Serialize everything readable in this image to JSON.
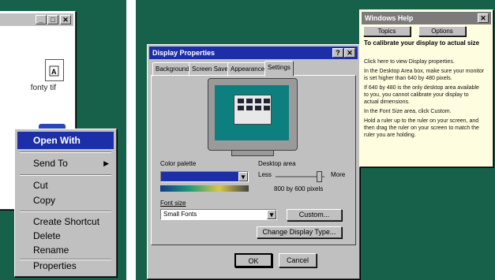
{
  "explorer": {
    "file_label": "fonty tif",
    "controls": {
      "minimize": "_",
      "maximize": "□",
      "close": "✕"
    }
  },
  "context_menu": {
    "items": [
      {
        "label": "Open With",
        "accel": "O",
        "selected": true
      },
      {
        "label": "Send To",
        "accel": "n",
        "submenu": true
      },
      {
        "label": "Cut",
        "accel": "t"
      },
      {
        "label": "Copy",
        "accel": "C"
      },
      {
        "label": "Create Shortcut",
        "accel": "S"
      },
      {
        "label": "Delete",
        "accel": "D"
      },
      {
        "label": "Rename",
        "accel": "m"
      },
      {
        "label": "Properties",
        "accel": "r"
      }
    ]
  },
  "display_properties": {
    "title": "Display Properties",
    "tabs": [
      "Background",
      "Screen Saver",
      "Appearance",
      "Settings"
    ],
    "active_tab": "Settings",
    "color_palette_label": "Color palette",
    "desktop_area_label": "Desktop area",
    "slider_less": "Less",
    "slider_more": "More",
    "resolution_text": "800 by 600 pixels",
    "font_size_label": "Font size",
    "font_size_value": "Small Fonts",
    "custom_button": "Custom...",
    "change_display_type_button": "Change Display Type...",
    "ok_button": "OK",
    "cancel_button": "Cancel"
  },
  "help": {
    "title": "Windows Help",
    "topics_button": "Topics",
    "options_button": "Options",
    "heading": "To calibrate your display to actual size",
    "lines": [
      "Click here to view Display properties.",
      "In the Desktop Area box, make sure your monitor",
      "is set higher than 640 by 480 pixels.",
      "If 640 by 480 is the only desktop area available",
      "to you, you cannot calibrate your display to",
      "actual dimensions.",
      "In the Font Size area, click Custom.",
      "Hold a ruler up to the ruler on your screen, and",
      "then drag the ruler on your screen to match the",
      "ruler you are holding."
    ]
  },
  "colors": {
    "background_green": "#17604a",
    "selection_blue": "#1c2fa8",
    "menu_gray": "#c0c0c0",
    "help_bg": "#fffde0"
  }
}
